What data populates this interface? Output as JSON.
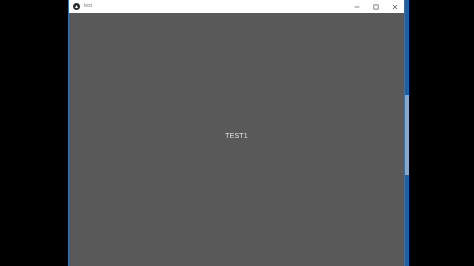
{
  "window": {
    "title": "test",
    "app_icon": "kivy-logo-icon",
    "controls": {
      "minimize_icon": "minimize-icon",
      "maximize_icon": "maximize-icon",
      "close_icon": "close-icon"
    }
  },
  "content": {
    "label": "TEST1"
  },
  "colors": {
    "window_background": "#595959",
    "titlebar": "#ffffff",
    "label_text": "#e6e6e6",
    "desktop_accent": "#1f5fa8"
  }
}
